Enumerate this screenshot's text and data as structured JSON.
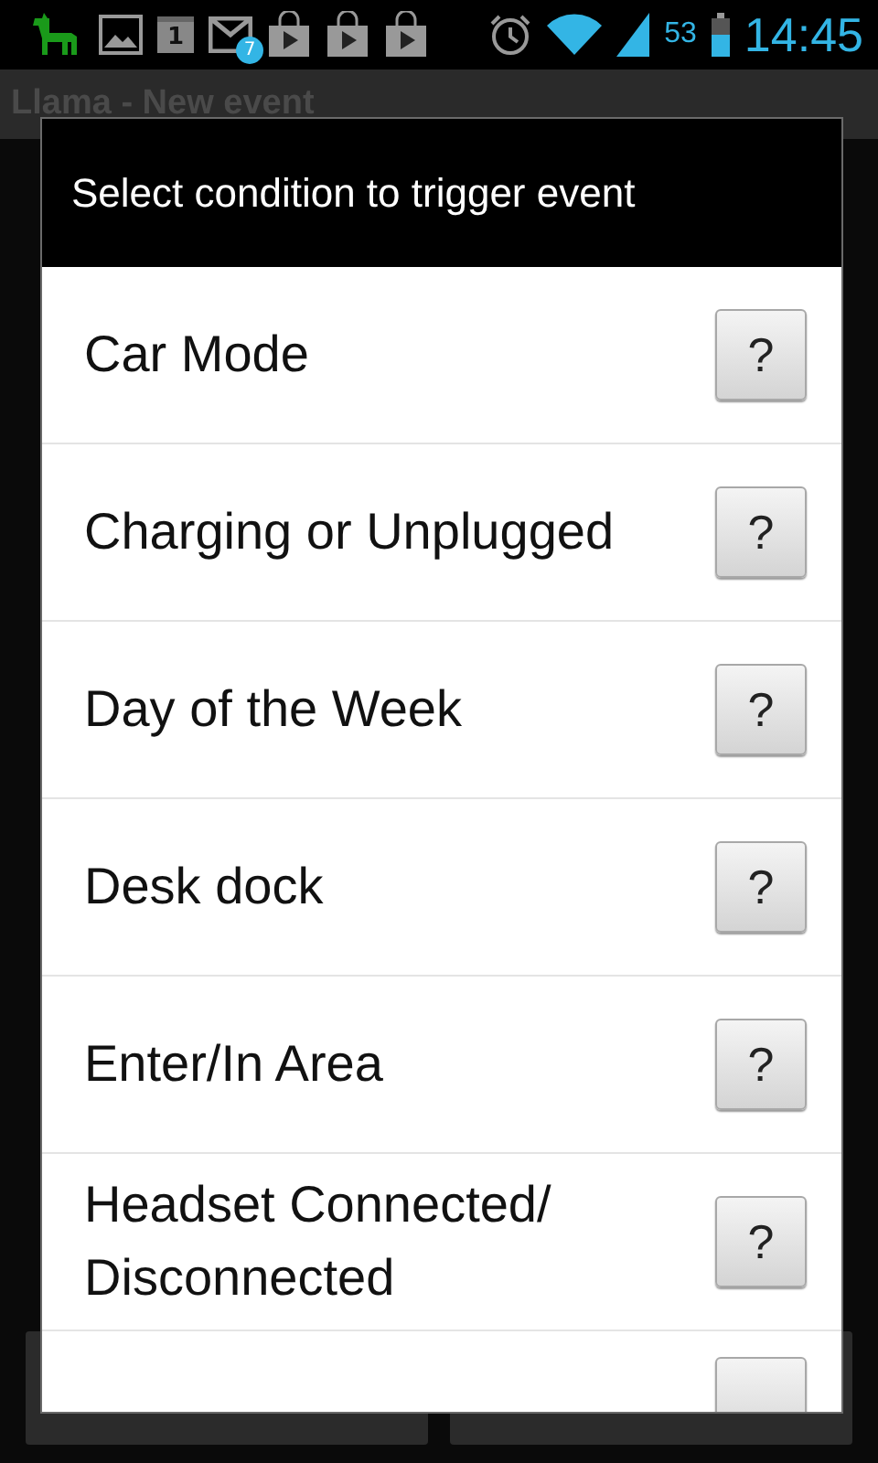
{
  "status_bar": {
    "calendar_day": "1",
    "mail_count": "7",
    "battery": "53",
    "time": "14:45"
  },
  "action_bar": {
    "title": "Llama - New event"
  },
  "dialog": {
    "title": "Select condition to trigger event",
    "items": [
      {
        "label": "Car Mode",
        "help": "?"
      },
      {
        "label": "Charging or Unplugged",
        "help": "?"
      },
      {
        "label": "Day of the Week",
        "help": "?"
      },
      {
        "label": "Desk dock",
        "help": "?"
      },
      {
        "label": "Enter/In Area",
        "help": "?"
      },
      {
        "label": "Headset Connected/ Disconnected",
        "help": "?"
      },
      {
        "kind": "partial"
      }
    ]
  }
}
